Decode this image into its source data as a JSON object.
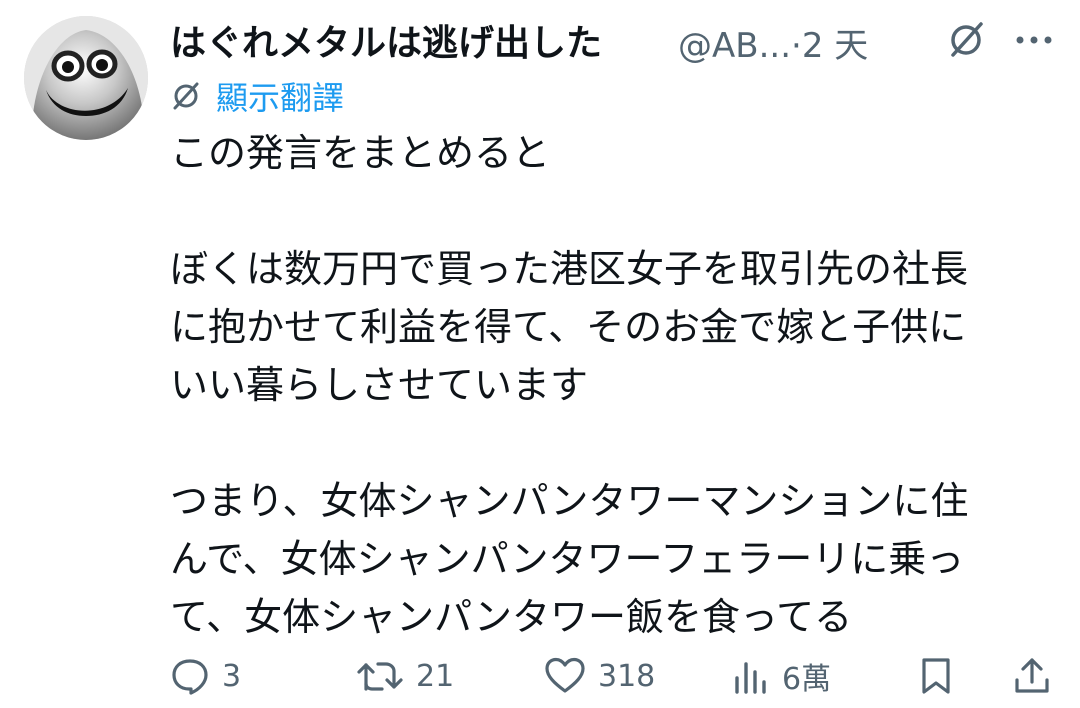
{
  "tweet": {
    "display_name": "はぐれメタルは逃げ出した",
    "handle": "@AB...",
    "separator": "·",
    "time": "2 天",
    "translate_label": "顯示翻譯",
    "body_lines": [
      "この発言をまとめると",
      "",
      "ぼくは数万円で買った港区女子を取引先の社長",
      "に抱かせて利益を得て、そのお金で嫁と子供に",
      "いい暮らしさせています",
      "",
      "つまり、女体シャンパンタワーマンションに住",
      "んで、女体シャンパンタワーフェラーリに乗っ",
      "て、女体シャンパンタワー飯を食ってる"
    ],
    "actions": {
      "replies": "3",
      "reposts": "21",
      "likes": "318",
      "views": "6萬"
    }
  },
  "icons": {
    "avatar": "metal-slime-avatar",
    "grok": "grok-icon",
    "more": "more-dots-icon",
    "translate": "grok-translate-icon",
    "reply": "reply-bubble-icon",
    "repost": "repost-arrows-icon",
    "like": "heart-icon",
    "views": "bar-chart-icon",
    "bookmark": "bookmark-icon",
    "share": "share-upload-icon"
  },
  "colors": {
    "text": "#0f1419",
    "muted": "#536471",
    "link": "#1d9bf0",
    "background": "#ffffff"
  }
}
